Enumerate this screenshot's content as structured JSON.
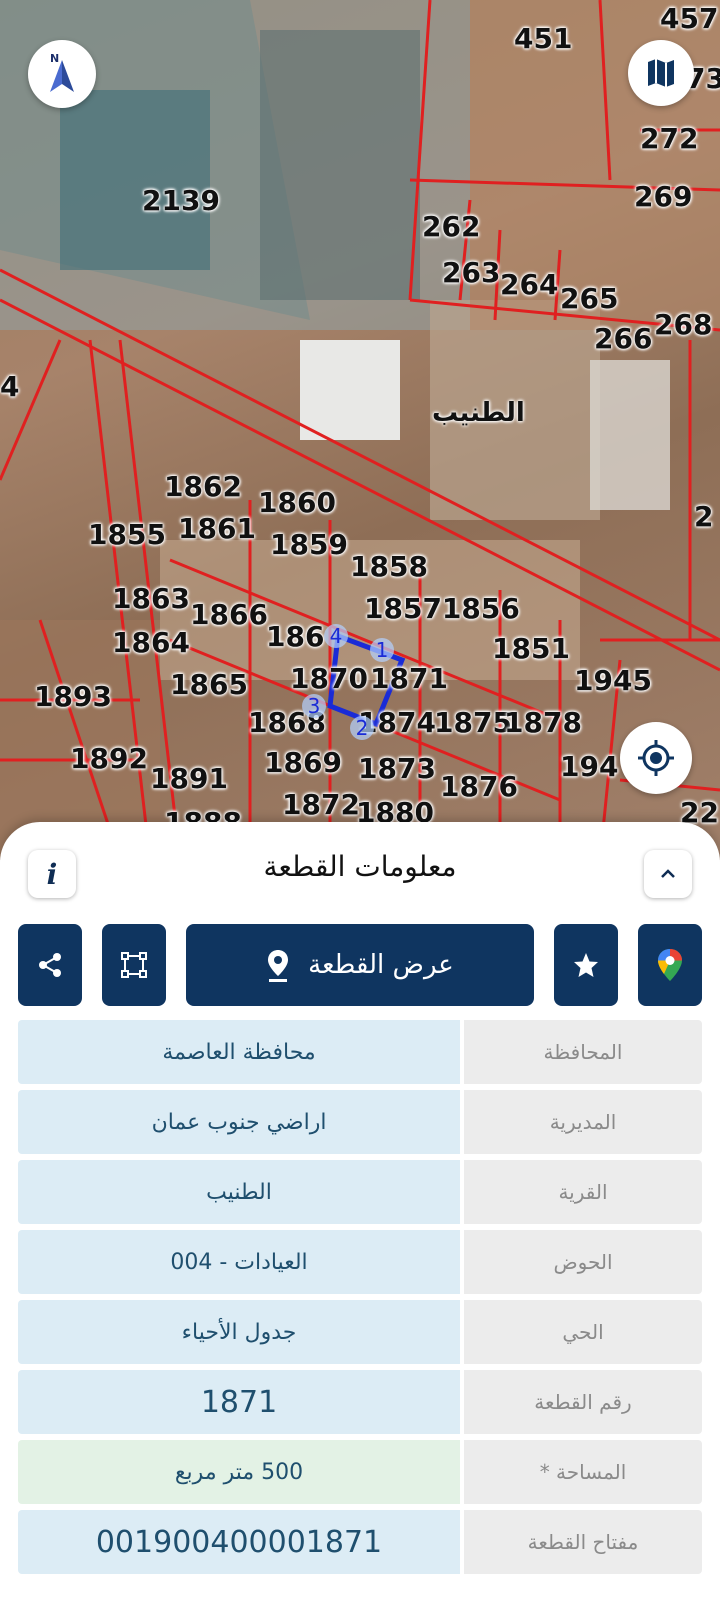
{
  "map": {
    "village_label": "الطنيب",
    "parcels": [
      {
        "text": "451"
      },
      {
        "text": "457"
      },
      {
        "text": "73"
      },
      {
        "text": "272"
      },
      {
        "text": "269"
      },
      {
        "text": "262"
      },
      {
        "text": "263"
      },
      {
        "text": "264"
      },
      {
        "text": "265"
      },
      {
        "text": "266"
      },
      {
        "text": "268"
      },
      {
        "text": "2139"
      },
      {
        "text": "4"
      },
      {
        "text": "2"
      },
      {
        "text": "1862"
      },
      {
        "text": "1860"
      },
      {
        "text": "1855"
      },
      {
        "text": "1861"
      },
      {
        "text": "1859"
      },
      {
        "text": "1858"
      },
      {
        "text": "1863"
      },
      {
        "text": "1866"
      },
      {
        "text": "18571856"
      },
      {
        "text": "1864"
      },
      {
        "text": "1865"
      },
      {
        "text": "1851"
      },
      {
        "text": "1945"
      },
      {
        "text": "1893"
      },
      {
        "text": "1870"
      },
      {
        "text": "1871"
      },
      {
        "text": "1868"
      },
      {
        "text": "1874"
      },
      {
        "text": "1875"
      },
      {
        "text": "1878"
      },
      {
        "text": "1892"
      },
      {
        "text": "1891"
      },
      {
        "text": "1869"
      },
      {
        "text": "1873"
      },
      {
        "text": "1876"
      },
      {
        "text": "194"
      },
      {
        "text": "1872"
      },
      {
        "text": "1880"
      },
      {
        "text": "1888"
      },
      {
        "text": "22"
      },
      {
        "text": "186"
      }
    ],
    "vertices": [
      "1",
      "2",
      "3",
      "4"
    ],
    "icons": {
      "compass": "north-arrow-icon",
      "layers": "map-layers-icon",
      "locate": "my-location-icon"
    }
  },
  "sheet": {
    "title": "معلومات القطعة",
    "show_parcel_label": "عرض القطعة",
    "rows": [
      {
        "label": "المحافظة",
        "value": "محافظة العاصمة"
      },
      {
        "label": "المديرية",
        "value": "اراضي جنوب عمان"
      },
      {
        "label": "القرية",
        "value": "الطنيب"
      },
      {
        "label": "الحوض",
        "value": "العيادات - 004"
      },
      {
        "label": "الحي",
        "value": "جدول الأحياء"
      },
      {
        "label": "رقم القطعة",
        "value": "1871"
      },
      {
        "label": "المساحة *",
        "value": "500  متر مربع"
      },
      {
        "label": "مفتاح القطعة",
        "value": "001900400001871"
      }
    ]
  },
  "colors": {
    "primary": "#0f3560",
    "value_bg": "#dcecf5",
    "label_bg": "#ececec",
    "area_bg": "#e3f2e5",
    "parcel_line": "#e02020",
    "highlight": "#1a2bd6"
  }
}
